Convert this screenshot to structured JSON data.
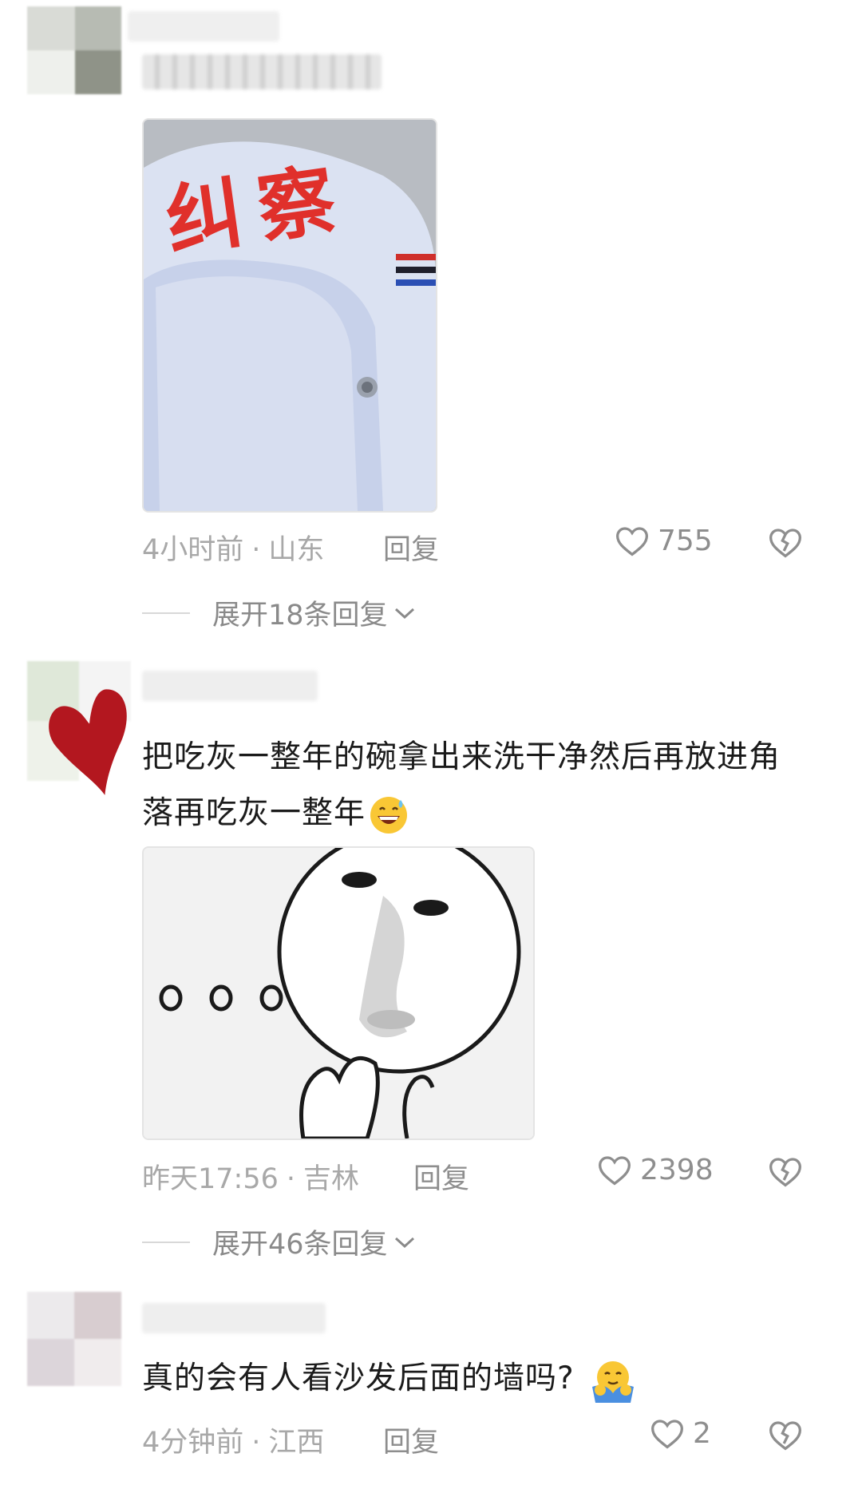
{
  "comments": [
    {
      "text": "",
      "time": "4小时前",
      "location": "山东",
      "reply_label": "回复",
      "likes": "755",
      "expand_label": "展开18条回复",
      "image_desc": "helmet",
      "helmet_text": "纠察"
    },
    {
      "text": "把吃灰一整年的碗拿出来洗干净然后再放进角落再吃灰一整年",
      "time": "昨天17:56",
      "location": "吉林",
      "reply_label": "回复",
      "likes": "2398",
      "expand_label": "展开46条回复",
      "image_desc": "meme-face",
      "meme_dots": "ooo"
    },
    {
      "text": "真的会有人看沙发后面的墙吗?",
      "time": "4分钟前",
      "location": "江西",
      "reply_label": "回复",
      "likes": "2"
    }
  ],
  "icons": {
    "like": "heart-outline-icon",
    "dislike": "broken-heart-icon",
    "expand": "chevron-down-icon",
    "emoji_grin": "grinning-sweat-emoji",
    "emoji_hug": "hugging-emoji"
  },
  "colors": {
    "meta": "#a8a8a8",
    "text": "#1b1b1b",
    "icon": "#8e8e8e",
    "helmet_red": "#e0302b"
  }
}
